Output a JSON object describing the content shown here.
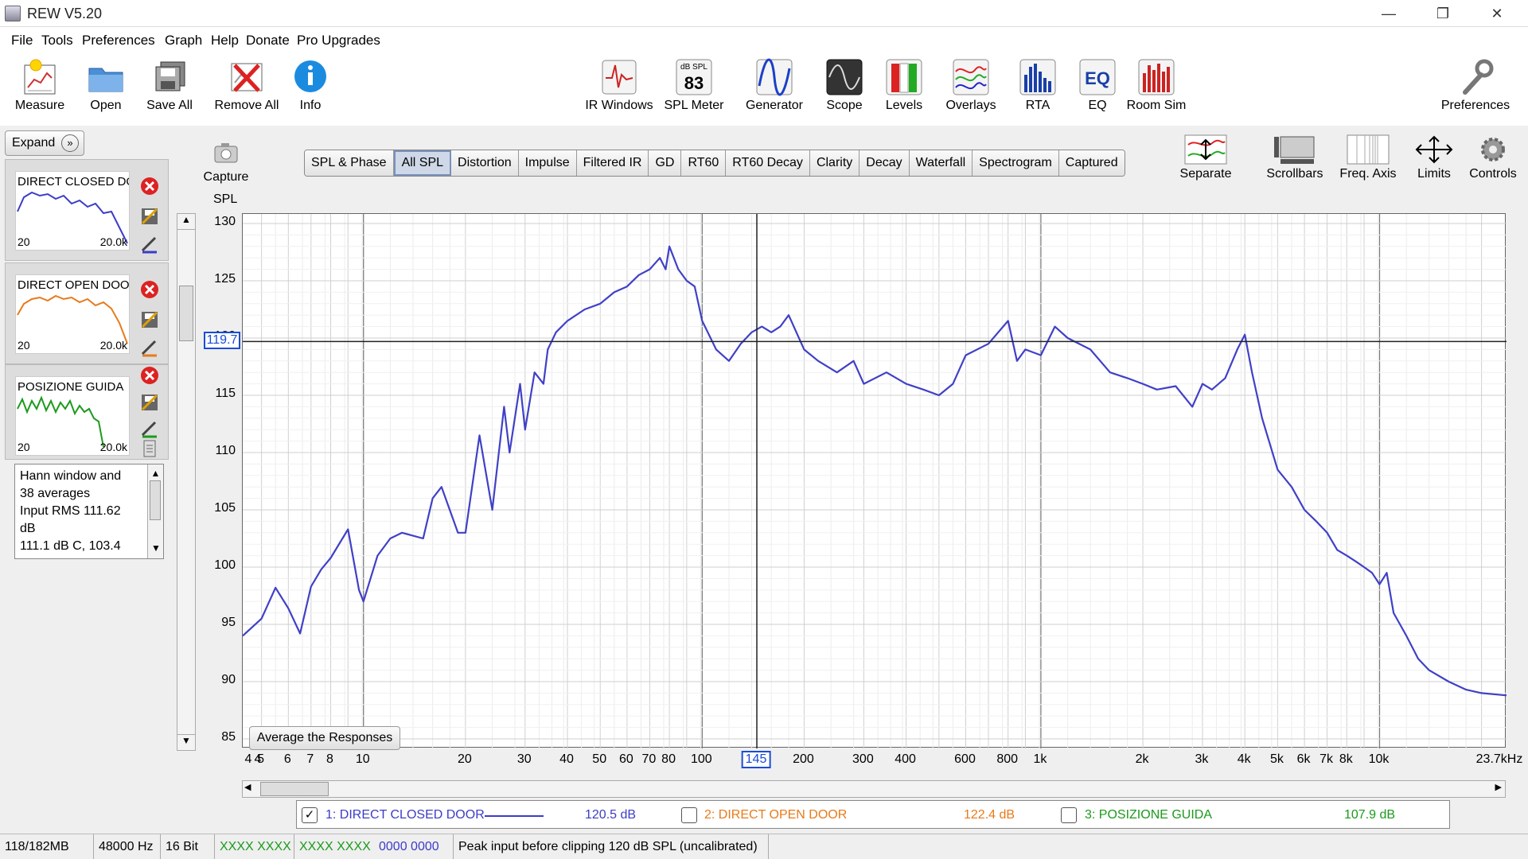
{
  "window": {
    "title": "REW V5.20",
    "minimize": "—",
    "restore": "❐",
    "close": "✕"
  },
  "menu": [
    "File",
    "Tools",
    "Preferences",
    "Graph",
    "Help",
    "Donate",
    "Pro Upgrades"
  ],
  "toolbar": {
    "measure": "Measure",
    "open": "Open",
    "save_all": "Save All",
    "remove_all": "Remove All",
    "info": "Info",
    "ir_windows": "IR Windows",
    "spl_meter": "SPL Meter",
    "spl_meter_top": "dB SPL",
    "spl_meter_value": "83",
    "generator": "Generator",
    "scope": "Scope",
    "levels": "Levels",
    "overlays": "Overlays",
    "rta": "RTA",
    "eq": "EQ",
    "eq_text": "EQ",
    "room_sim": "Room Sim",
    "preferences": "Preferences"
  },
  "graph_toolbar": {
    "capture": "Capture",
    "separate": "Separate",
    "scrollbars": "Scrollbars",
    "freq_axis": "Freq. Axis",
    "limits": "Limits",
    "controls": "Controls"
  },
  "tabs": [
    "SPL & Phase",
    "All SPL",
    "Distortion",
    "Impulse",
    "Filtered IR",
    "GD",
    "RT60",
    "RT60 Decay",
    "Clarity",
    "Decay",
    "Waterfall",
    "Spectrogram",
    "Captured"
  ],
  "active_tab": "All SPL",
  "left_panel": {
    "expand_label": "Expand",
    "measurements": [
      {
        "name": "DIRECT CLOSED DOOR",
        "thumb_title": "DIRECT CLOSED DO",
        "range_low": "20",
        "range_high": "20.0k",
        "color": "#3c3cc8"
      },
      {
        "name": "DIRECT OPEN DOOR",
        "thumb_title": "DIRECT OPEN DOO",
        "range_low": "20",
        "range_high": "20.0k",
        "color": "#e87a1a"
      },
      {
        "name": "POSIZIONE GUIDA",
        "thumb_title": "POSIZIONE GUIDA",
        "range_low": "20",
        "range_high": "20.0k",
        "color": "#1c9a1c"
      }
    ],
    "info_lines": [
      "Hann window and",
      "38 averages",
      "Input RMS 111.62",
      "dB",
      "111.1 dB C, 103.4"
    ]
  },
  "chart_data": {
    "type": "line",
    "ylabel": "SPL",
    "xunit": "Hz",
    "ylim": [
      85,
      130
    ],
    "xlim": [
      4.4,
      23700
    ],
    "y_ticks": [
      "130",
      "125",
      "120",
      "115",
      "110",
      "105",
      "100",
      "95",
      "90",
      "85"
    ],
    "x_ticks": [
      "4",
      "4",
      "5",
      "6",
      "7",
      "8",
      "10",
      "20",
      "30",
      "40",
      "50",
      "60",
      "70",
      "80",
      "100",
      "200",
      "300",
      "400",
      "600",
      "800",
      "1k",
      "2k",
      "3k",
      "4k",
      "5k",
      "6k",
      "7k",
      "8k",
      "10k",
      "23.7kHz"
    ],
    "cursor": {
      "x_label": "145",
      "y_label": "119.7"
    },
    "series": [
      {
        "name": "1: DIRECT CLOSED DOOR",
        "color": "#4040c8",
        "x": [
          4.4,
          5,
          5.5,
          6,
          6.5,
          7,
          7.5,
          8,
          9,
          9.7,
          10,
          11,
          12,
          13,
          15,
          16,
          17,
          19,
          20,
          22,
          24,
          26,
          27,
          29,
          30,
          32,
          34,
          35,
          37,
          40,
          45,
          50,
          55,
          60,
          65,
          70,
          75,
          78,
          80,
          85,
          90,
          95,
          100,
          110,
          120,
          130,
          140,
          150,
          160,
          170,
          180,
          200,
          220,
          250,
          280,
          300,
          350,
          400,
          450,
          500,
          550,
          600,
          700,
          800,
          850,
          900,
          1000,
          1100,
          1200,
          1400,
          1600,
          1800,
          2000,
          2200,
          2500,
          2800,
          3000,
          3200,
          3500,
          3800,
          4000,
          4200,
          4500,
          5000,
          5500,
          6000,
          6500,
          7000,
          7500,
          8000,
          8500,
          9000,
          9500,
          10000,
          10500,
          11000,
          12000,
          13000,
          14000,
          16000,
          18000,
          20000,
          23700
        ],
        "y": [
          94,
          95.5,
          98.2,
          96.4,
          94.2,
          98.3,
          99.8,
          100.8,
          103.3,
          98,
          97,
          101,
          102.5,
          103,
          102.5,
          106,
          107,
          103,
          103,
          111.5,
          105,
          114,
          110,
          116,
          112,
          117,
          116,
          119,
          120.5,
          121.5,
          122.5,
          123,
          124,
          124.5,
          125.5,
          126,
          127,
          126,
          128,
          126,
          125,
          124.5,
          121.5,
          119,
          118,
          119.5,
          120.5,
          121,
          120.5,
          121,
          122,
          119,
          118,
          117,
          118,
          116,
          117,
          116,
          115.5,
          115,
          116,
          118.5,
          119.5,
          121.5,
          118,
          119,
          118.5,
          121,
          120,
          119,
          117,
          116.5,
          116,
          115.5,
          115.8,
          114,
          116,
          115.5,
          116.5,
          119,
          120.3,
          117,
          113,
          108.5,
          107,
          105,
          104,
          103,
          101.5,
          101,
          100.5,
          100,
          99.5,
          98.5,
          99.5,
          96,
          94,
          92,
          91,
          90,
          89.3,
          89,
          88.8
        ]
      },
      {
        "name": "2: DIRECT OPEN DOOR",
        "color": "#e87a1a",
        "x": [],
        "y": []
      },
      {
        "name": "3: POSIZIONE GUIDA",
        "color": "#1c9a1c",
        "x": [],
        "y": []
      }
    ]
  },
  "graph_button": "Average the Responses",
  "legend": [
    {
      "label": "1: DIRECT CLOSED DOOR",
      "value": "120.5 dB",
      "checked": true,
      "check_glyph": "✓",
      "color": "#3c3cc8"
    },
    {
      "label": "2: DIRECT OPEN DOOR",
      "value": "122.4 dB",
      "checked": false,
      "check_glyph": "",
      "color": "#e87a1a"
    },
    {
      "label": "3: POSIZIONE GUIDA",
      "value": "107.9 dB",
      "checked": false,
      "check_glyph": "",
      "color": "#1c9a1c"
    }
  ],
  "status": {
    "memory": "118/182MB",
    "sample_rate": "48000 Hz",
    "bits": "16 Bit",
    "meters_a": "XXXX XXXX",
    "meters_b": "XXXX XXXX",
    "meters_c": "0000 0000",
    "message": "Peak input before clipping 120 dB SPL (uncalibrated)"
  }
}
